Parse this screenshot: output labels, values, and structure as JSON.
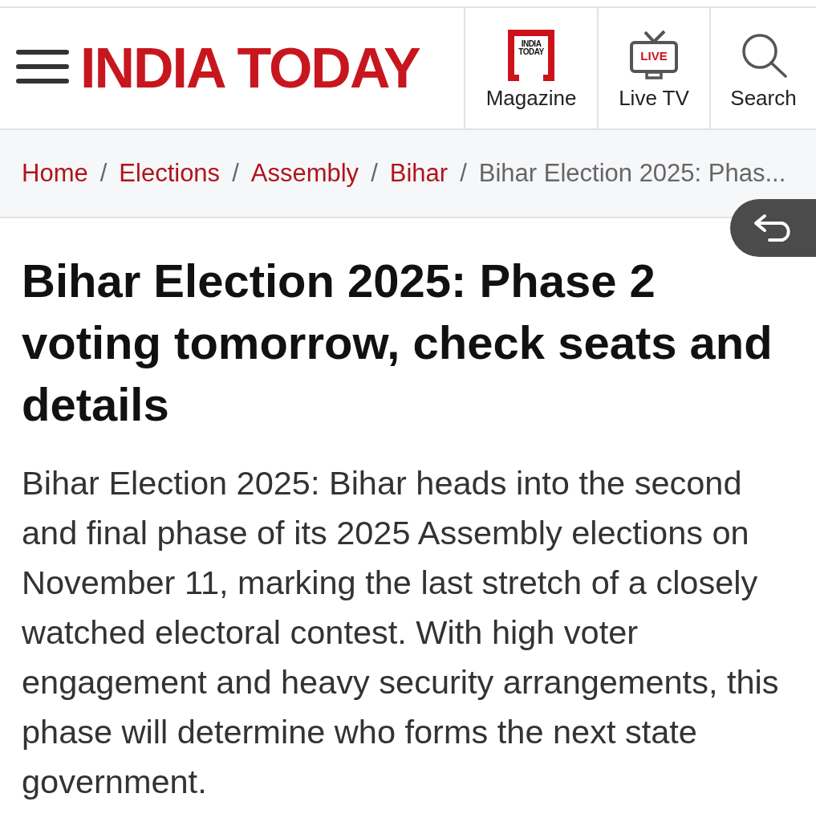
{
  "header": {
    "logo": "INDIA TODAY",
    "nav": [
      {
        "kind": "magazine",
        "label": "Magazine",
        "badge": "INDIA TODAY"
      },
      {
        "kind": "live",
        "label": "Live TV",
        "badge": "LIVE"
      },
      {
        "kind": "search",
        "label": "Search"
      }
    ]
  },
  "breadcrumb": [
    {
      "label": "Home",
      "current": false
    },
    {
      "separator": "/",
      "label": "Elections",
      "current": false
    },
    {
      "separator": "/",
      "label": "Assembly",
      "current": false
    },
    {
      "separator": "/",
      "label": "Bihar",
      "current": false
    },
    {
      "separator": "/",
      "label": "Bihar Election 2025: Phas...",
      "current": true
    }
  ],
  "article": {
    "headline": "Bihar Election 2025: Phase 2 voting tomorrow, check seats and details",
    "summary": "Bihar Election 2025: Bihar heads into the second and final phase of its 2025 Assembly elections on November 11, marking the last stretch of a closely watched electoral contest. With high voter engagement and heavy security arrangements, this phase will determine who forms the next state government."
  }
}
